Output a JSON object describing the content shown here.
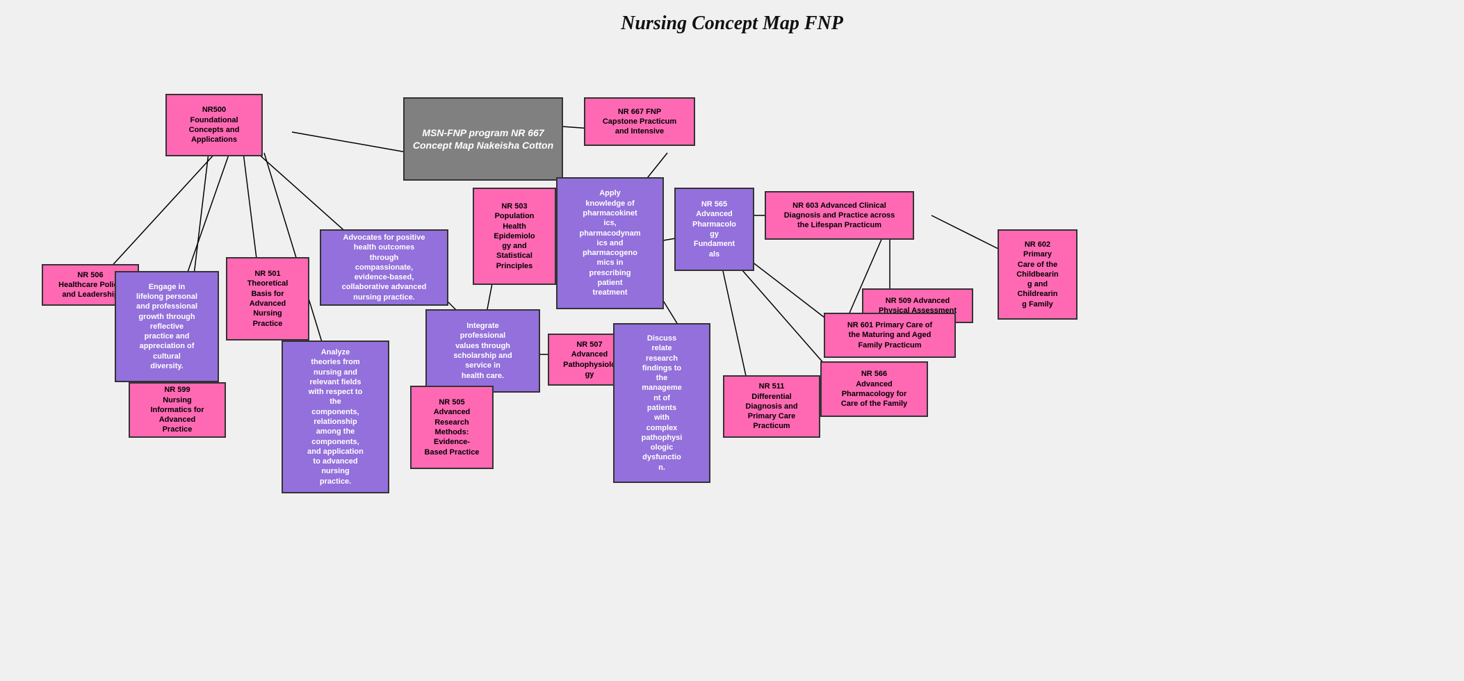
{
  "title": "Nursing Concept Map FNP",
  "nodes": {
    "main_title": "MSN-FNP program\nNR 667\nConcept Map\nNakeisha Cotton",
    "nr500": "NR500\nFoundational\nConcepts and\nApplications",
    "nr667_capstone": "NR 667 FNP\nCapstone Practicum\nand Intensive",
    "nr506": "NR 506\nHealthcare Policy\nand Leadership",
    "engage_lifelong": "Engage in\nlifelong personal\nand professional\ngrowth through\nreflective\npractice and\nappreciation of\ncultural\ndiversity.",
    "nr501": "NR 501\nTheoretical\nBasis for\nAdvanced\nNursing\nPractice",
    "nr599": "NR 599\nNursing\nInformatics for\nAdvanced\nPractice",
    "advocates": "Advocates for positive\nhealth outcomes\nthrough\ncompassionate,\nevidence-based,\ncollaborative advanced\nnursing practice.",
    "analyze": "Analyze\ntheories from\nnursing and\nrelevant fields\nwith respect to\nthe\ncomponents,\nrelationship\namong the\ncomponents,\nand application\nto advanced\nnursing\npractice.",
    "nr503": "NR 503\nPopulation\nHealth\nEpidemiolo\ngy and\nStatistical\nPrinciples",
    "apply_pharmaco": "Apply\nknowledge of\npharmacokinet\nics,\npharmacodynam\nics and\npharmacogeno\nmics in\nprescribing\npatient\ntreatment",
    "nr565": "NR 565\nAdvanced\nPharmacolo\ngy\nFundament\nals",
    "nr603": "NR 603 Advanced Clinical\nDiagnosis and Practice across\nthe Lifespan Practicum",
    "nr602": "NR 602\nPrimary\nCare of the\nChildbearin\ng and\nChildrearin\ng Family",
    "nr509": "NR 509 Advanced\nPhysical Assessment",
    "integrate": "Integrate\nprofessional\nvalues through\nscholarship and\nservice in\nhealth care.",
    "nr507": "NR 507\nAdvanced\nPathophysiolo\ngy",
    "nr505": "NR 505\nAdvanced\nResearch\nMethods:\nEvidence-\nBased Practice",
    "discuss": "Discuss\nrelate\nresearch\nfindings to\nthe\nmanageme\nnt of\npatients\nwith\ncomplex\npathophysi\nologic\ndysfunctio\nn.",
    "nr511": "NR 511\nDifferential\nDiagnosis and\nPrimary Care\nPracticum",
    "nr566": "NR 566\nAdvanced\nPharmacology for\nCare of the Family",
    "nr601": "NR 601 Primary Care of\nthe Maturing and Aged\nFamily Practicum"
  },
  "colors": {
    "pink": "#FF69B4",
    "purple": "#9370DB",
    "gray": "#808080",
    "white": "#ffffff"
  }
}
